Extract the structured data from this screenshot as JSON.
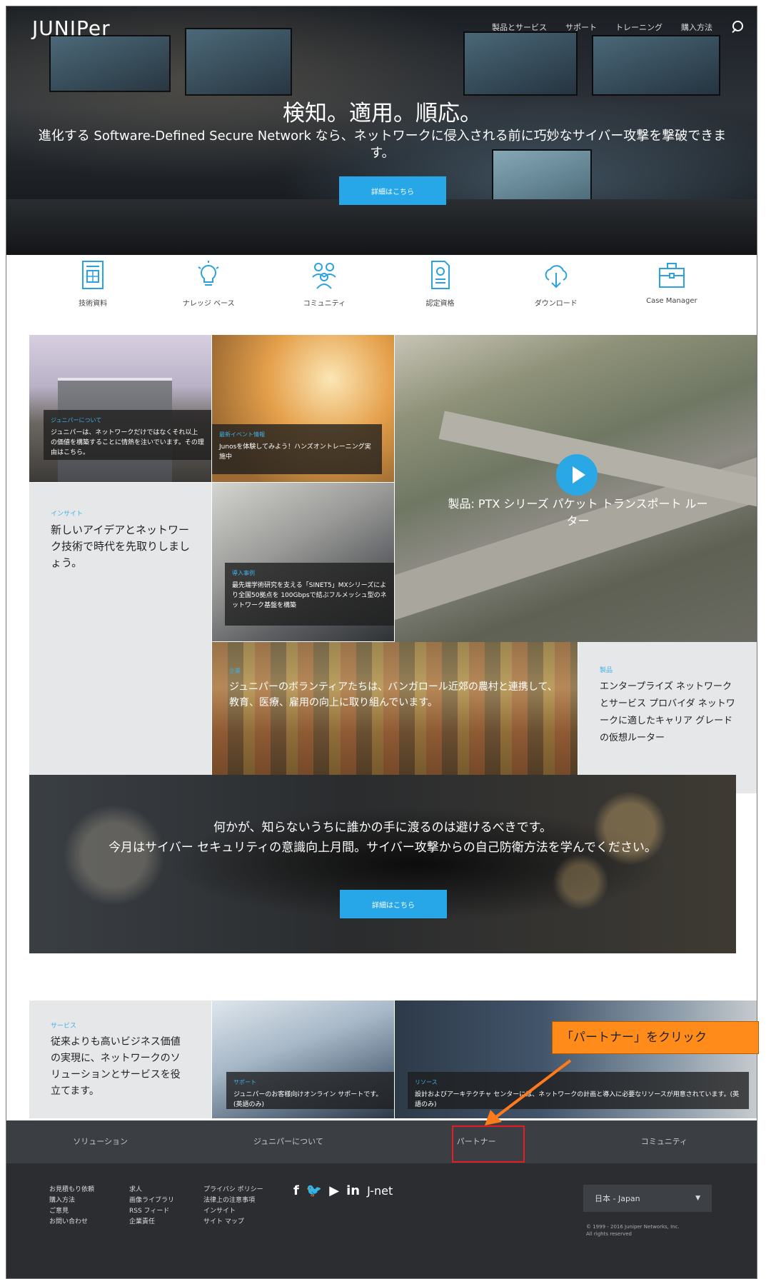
{
  "header": {
    "logo": "JUNIPer",
    "nav": [
      "製品とサービス",
      "サポート",
      "トレーニング",
      "購入方法"
    ]
  },
  "hero": {
    "title": "検知。適用。順応。",
    "subtitle": "進化する Software-Defined Secure Network なら、ネットワークに侵入される前に巧妙なサイバー攻撃を撃破できます。",
    "button": "詳細はこちら"
  },
  "quick_links": [
    {
      "label": "技術資料",
      "icon": "document-grid-icon"
    },
    {
      "label": "ナレッジ ベース",
      "icon": "lightbulb-icon"
    },
    {
      "label": "コミュニティ",
      "icon": "community-icon"
    },
    {
      "label": "認定資格",
      "icon": "certificate-icon"
    },
    {
      "label": "ダウンロード",
      "icon": "cloud-download-icon"
    },
    {
      "label": "Case Manager",
      "icon": "briefcase-icon"
    }
  ],
  "tiles": {
    "about": {
      "cat": "ジュニパーについて",
      "text": "ジュニパーは、ネットワークだけではなくそれ以上の価値を構築することに情熱を注いでいます。その理由はこちら。"
    },
    "events": {
      "cat": "最新イベント情報",
      "text": "Junosを体験してみよう！ハンズオントレーニング実施中"
    },
    "video": {
      "text": "製品: PTX シリーズ パケット トランスポート ルーター"
    },
    "insight": {
      "cat": "インサイト",
      "text": "新しいアイデアとネットワーク技術で時代を先取りしましょう。"
    },
    "case": {
      "cat": "導入事例",
      "text": "最先端学術研究を支える「SINET5」MXシリーズにより全国50拠点を 100Gbpsで結ぶフルメッシュ型のネットワーク基盤を構築"
    },
    "volunteer": {
      "cat": "企業",
      "text": "ジュニパーのボランティアたちは、バンガロール近郊の農村と連携して、教育、医療、雇用の向上に取り組んでいます。"
    },
    "product": {
      "cat": "製品",
      "text": "エンタープライズ ネットワークとサービス プロバイダ ネットワークに適したキャリア グレードの仮想ルーター"
    }
  },
  "banner": {
    "line1": "何かが、知らないうちに誰かの手に渡るのは避けるべきです。",
    "line2": "今月はサイバー セキュリティの意識向上月間。サイバー攻撃からの自己防衛方法を学んでください。",
    "button": "詳細はこちら"
  },
  "bottom_tiles": {
    "services": {
      "cat": "サービス",
      "text": "従来よりも高いビジネス価値の実現に、ネットワークのソリューションとサービスを役立てます。"
    },
    "support": {
      "cat": "サポート",
      "text": "ジュニパーのお客様向けオンライン サポートです。(英語のみ)"
    },
    "resources": {
      "cat": "リソース",
      "text": "設計およびアーキテクチャ センターには、ネットワークの計画と導入に必要なリソースが用意されています。(英語のみ)"
    }
  },
  "footer_nav": [
    "ソリューション",
    "ジュニパーについて",
    "パートナー",
    "コミュニティ"
  ],
  "footer": {
    "col1": [
      "お見積もり依頼",
      "購入方法",
      "ご意見",
      "お問い合わせ"
    ],
    "col2": [
      "求人",
      "画像ライブラリ",
      "RSS フィード",
      "企業責任"
    ],
    "col3": [
      "プライバシ ポリシー",
      "法律上の注意事項",
      "インサイト",
      "サイト マップ"
    ],
    "social": [
      "f",
      "🐦",
      "▶",
      "in",
      "J-net"
    ],
    "language": "日本 - Japan",
    "copyright": [
      "© 1999 - 2016 Juniper Networks, Inc.",
      "All rights reserved"
    ]
  },
  "annotation": {
    "callout": "「パートナー」をクリック",
    "accent": "#ff8c1a"
  }
}
